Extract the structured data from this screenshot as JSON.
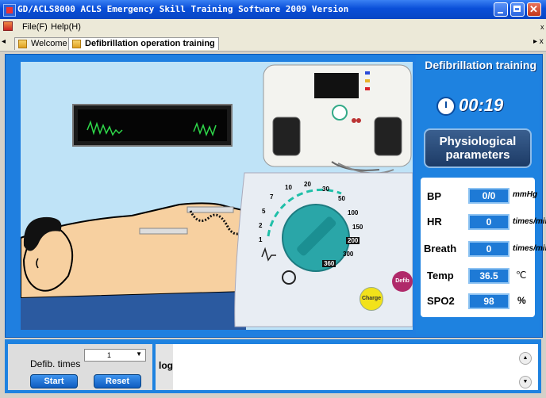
{
  "window": {
    "title": "GD/ACLS8000 ACLS Emergency Skill Training Software 2009 Version"
  },
  "menu": {
    "items": [
      "File(F)",
      "Help(H)"
    ]
  },
  "tabs": [
    {
      "label": "Welcome",
      "active": false
    },
    {
      "label": "Defibrillation operation training",
      "active": true
    }
  ],
  "panel": {
    "title": "Defibrillation training",
    "timer": "00:19",
    "phys_button_line1": "Physiological",
    "phys_button_line2": "parameters",
    "vitals": [
      {
        "label": "BP",
        "value": "0/0",
        "unit": "mmHg"
      },
      {
        "label": "HR",
        "value": "0",
        "unit": "times/min"
      },
      {
        "label": "Breath",
        "value": "0",
        "unit": "times/min"
      },
      {
        "label": "Temp",
        "value": "36.5",
        "unit": "℃"
      },
      {
        "label": "SPO2",
        "value": "98",
        "unit": "%"
      }
    ]
  },
  "device": {
    "energy_labels": [
      "10",
      "20",
      "30",
      "50",
      "100",
      "150",
      "200",
      "300",
      "360",
      "7",
      "5",
      "2",
      "1"
    ],
    "charge_label": "Charge",
    "defib_label": "Defib"
  },
  "controls": {
    "defib_times_label": "Defib. times",
    "defib_times_value": "1",
    "start_label": "Start",
    "reset_label": "Reset",
    "log_label": "log"
  },
  "colors": {
    "titlebar": "#0a4fd8",
    "panel": "#1e82e0",
    "stage": "#bfe3f7",
    "ecg": "#2fd84a",
    "charge": "#f2e21b",
    "defib": "#b02a6a"
  }
}
